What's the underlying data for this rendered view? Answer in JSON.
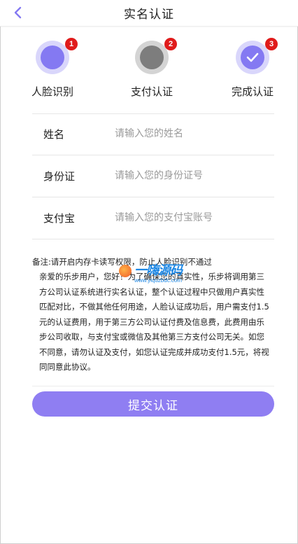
{
  "header": {
    "title": "实名认证",
    "back_icon": "chevron-left-icon"
  },
  "steps": [
    {
      "label": "人脸识别",
      "badge": "1",
      "state": "active",
      "color": "#8479f2"
    },
    {
      "label": "支付认证",
      "badge": "2",
      "state": "inactive",
      "color": "#7d7d7d"
    },
    {
      "label": "完成认证",
      "badge": "3",
      "state": "done",
      "color": "#8479f2",
      "icon": "check-icon"
    }
  ],
  "form": {
    "name": {
      "label": "姓名",
      "placeholder": "请输入您的姓名",
      "value": ""
    },
    "id_card": {
      "label": "身份证",
      "placeholder": "请输入您的身份证号",
      "value": ""
    },
    "alipay": {
      "label": "支付宝",
      "placeholder": "请输入您的支付宝账号",
      "value": ""
    }
  },
  "note": {
    "title": "备注:请开启内存卡读写权限，防止人脸识别不通过",
    "body": "亲爱的乐步用户，您好！为了确保您的真实性，乐步将调用第三方公司认证系统进行实名认证，整个认证过程中只做用户真实性匹配对比，不做其他任何用途，人脸认证成功后，用户需支付1.5元的认证费用，用于第三方公司认证付费及信息费，此费用由乐步公司收取，与支付宝或微信及其他第三方支付公司无关。如您不同意，请勿认证及支付，如您认证完成并成功支付1.5元，将视同同意此协议。"
  },
  "watermark": {
    "text": "一嗨源码",
    "url": "www.yiquzbdc.com"
  },
  "submit": {
    "label": "提交认证",
    "color": "#8f7ef2"
  },
  "colors": {
    "accent": "#8479f2",
    "badge": "#e01b1b",
    "inactive": "#7d7d7d"
  }
}
